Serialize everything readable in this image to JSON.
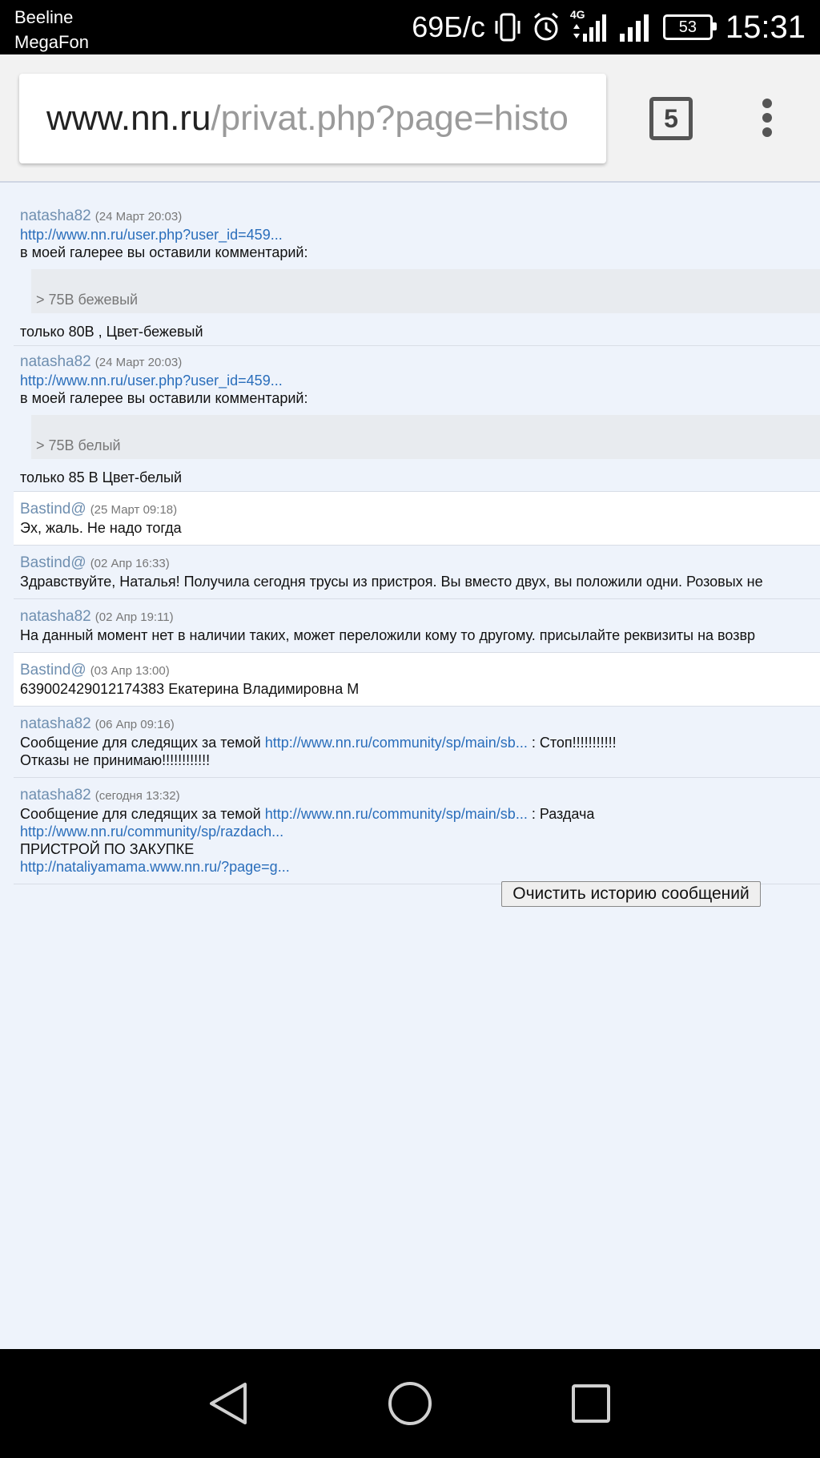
{
  "status_bar": {
    "carrier1": "Beeline",
    "carrier2": "MegaFon",
    "speed": "69Б/с",
    "network_label": "4G",
    "battery": "53",
    "time": "15:31"
  },
  "browser": {
    "url_domain": "www.nn.ru",
    "url_path": "/privat.php?page=histo",
    "tab_count": "5"
  },
  "messages": [
    {
      "author": "natasha82",
      "date": "(24 Март 20:03)",
      "link": "http://www.nn.ru/user.php?user_id=459...",
      "text1": "в моей галерее вы оставили комментарий:",
      "quote": "> 75В бежевый",
      "text2": "только 80В , Цвет-бежевый"
    },
    {
      "author": "natasha82",
      "date": "(24 Март 20:03)",
      "link": "http://www.nn.ru/user.php?user_id=459...",
      "text1": "в моей галерее вы оставили комментарий:",
      "quote": "> 75В белый",
      "text2": "только 85 В Цвет-белый"
    },
    {
      "author": "Bastind@",
      "date": "(25 Март 09:18)",
      "text": "Эх, жаль. Не надо тогда"
    },
    {
      "author": "Bastind@",
      "date": "(02 Апр 16:33)",
      "text": "Здравствуйте, Наталья! Получила сегодня трусы из пристроя. Вы вместо двух, вы положили одни. Розовых не"
    },
    {
      "author": "natasha82",
      "date": "(02 Апр 19:11)",
      "text": "На данный момент нет в наличии таких, может переложили кому то другому. присылайте реквизиты на возвр"
    },
    {
      "author": "Bastind@",
      "date": "(03 Апр 13:00)",
      "text": "639002429012174383 Екатерина Владимировна М"
    },
    {
      "author": "natasha82",
      "date": "(06 Апр 09:16)",
      "prefix": "Сообщение для следящих за темой ",
      "link": "http://www.nn.ru/community/sp/main/sb...",
      "suffix": " : Стоп!!!!!!!!!!!",
      "line2": "Отказы не принимаю!!!!!!!!!!!!"
    },
    {
      "author": "natasha82",
      "date": "(сегодня 13:32)",
      "prefix": "Сообщение для следящих за темой ",
      "link": "http://www.nn.ru/community/sp/main/sb...",
      "suffix": " : Раздача",
      "link2": "http://www.nn.ru/community/sp/razdach...",
      "line3": "ПРИСТРОЙ ПО ЗАКУПКЕ",
      "link3": "http://nataliyamama.www.nn.ru/?page=g..."
    }
  ],
  "clear_button": "Очистить историю сообщений"
}
